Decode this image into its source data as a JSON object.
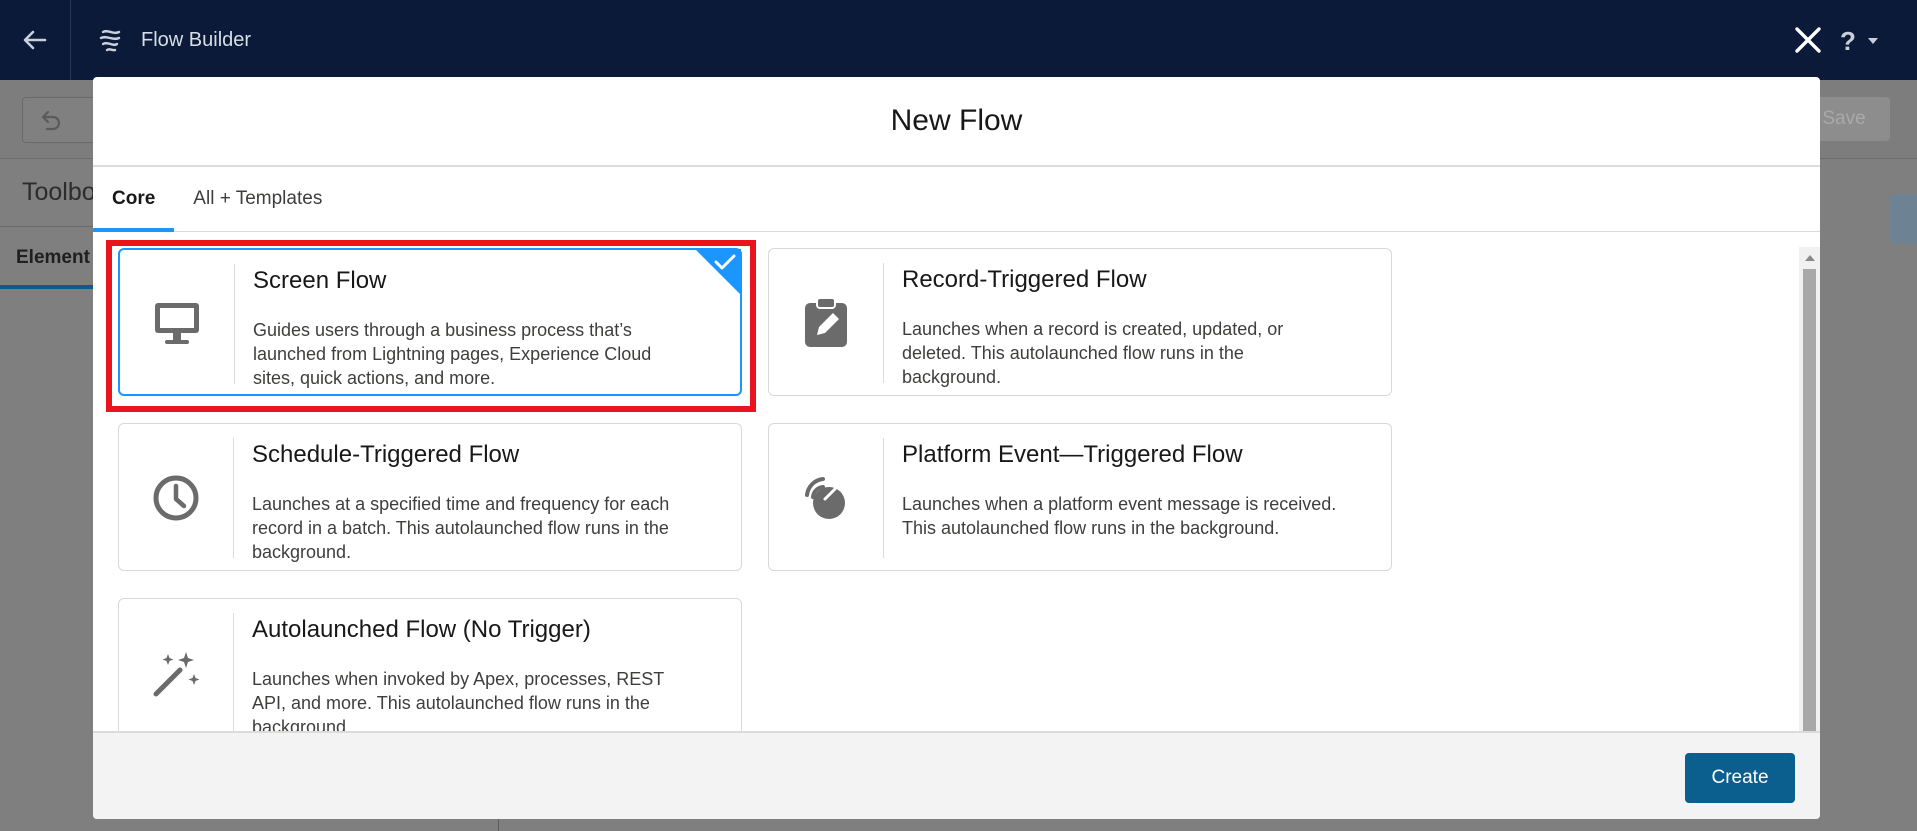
{
  "app": {
    "title": "Flow Builder"
  },
  "background": {
    "save_label": "Save",
    "toolbox_title": "Toolbo",
    "elements_tab": "Element"
  },
  "modal": {
    "title": "New Flow",
    "tabs": [
      {
        "label": "Core",
        "active": true
      },
      {
        "label": "All + Templates",
        "active": false
      }
    ],
    "cards": [
      {
        "title": "Screen Flow",
        "description": "Guides users through a business process that’s launched from Lightning pages, Experience Cloud sites, quick actions, and more.",
        "icon": "monitor-icon",
        "selected": true
      },
      {
        "title": "Record-Triggered Flow",
        "description": "Launches when a record is created, updated, or deleted. This autolaunched flow runs in the background.",
        "icon": "clipboard-edit-icon",
        "selected": false
      },
      {
        "title": "Schedule-Triggered Flow",
        "description": "Launches at a specified time and frequency for each record in a batch. This autolaunched flow runs in the background.",
        "icon": "clock-icon",
        "selected": false
      },
      {
        "title": "Platform Event—Triggered Flow",
        "description": "Launches when a platform event message is received. This autolaunched flow runs in the background.",
        "icon": "satellite-dish-icon",
        "selected": false
      },
      {
        "title": "Autolaunched Flow (No Trigger)",
        "description": "Launches when invoked by Apex, processes, REST API, and more. This autolaunched flow runs in the background.",
        "icon": "magic-wand-icon",
        "selected": false
      }
    ],
    "create_label": "Create"
  },
  "colors": {
    "header_bg": "#0b1a39",
    "accent": "#1b96ff",
    "create_button": "#0b5f8e",
    "highlight": "#e8141e"
  }
}
